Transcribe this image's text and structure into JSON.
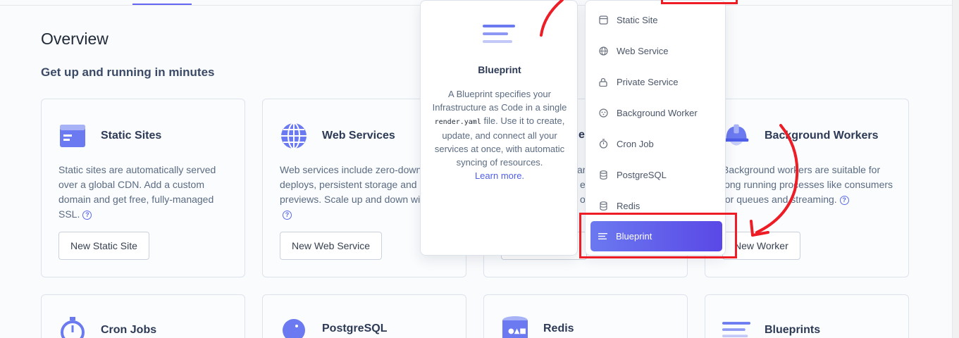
{
  "page": {
    "title": "Overview",
    "subtitle": "Get up and running in minutes"
  },
  "cards": {
    "static_sites": {
      "title": "Static Sites",
      "description": "Static sites are automatically served over a global CDN. Add a custom domain and get free, fully-managed SSL.",
      "button": "New Static Site"
    },
    "web_services": {
      "title": "Web Services",
      "description": "Web services include zero-downtime deploys, persistent storage and PR previews. Scale up and down with ease.",
      "button": "New Web Service"
    },
    "private_services": {
      "title_partial": "e S",
      "desc_partial": [
        "ar",
        "e",
        "o"
      ]
    },
    "background_workers": {
      "title": "Background Workers",
      "description": "Background workers are suitable for long running processes like consumers for queues and streaming.",
      "button": "New Worker"
    },
    "cron_jobs": {
      "title": "Cron Jobs"
    },
    "postgresql": {
      "title": "PostgreSQL"
    },
    "redis": {
      "title": "Redis"
    },
    "blueprints": {
      "title": "Blueprints"
    }
  },
  "popover": {
    "title": "Blueprint",
    "desc_before": "A Blueprint specifies your Infrastructure as Code in a single",
    "code": "render.yaml",
    "desc_after": "file. Use it to create, update, and connect all your services at once, with automatic syncing of resources.",
    "link": "Learn more."
  },
  "dropdown": {
    "items": [
      {
        "label": "Static Site",
        "icon": "static-site-icon"
      },
      {
        "label": "Web Service",
        "icon": "globe-icon"
      },
      {
        "label": "Private Service",
        "icon": "lock-icon"
      },
      {
        "label": "Background Worker",
        "icon": "worker-icon"
      },
      {
        "label": "Cron Job",
        "icon": "stopwatch-icon"
      },
      {
        "label": "PostgreSQL",
        "icon": "database-icon"
      },
      {
        "label": "Redis",
        "icon": "database-icon"
      },
      {
        "label": "Blueprint",
        "icon": "blueprint-icon",
        "active": true
      }
    ]
  },
  "colors": {
    "accent": "#6366f1",
    "annotation_red": "#ee1c25"
  }
}
